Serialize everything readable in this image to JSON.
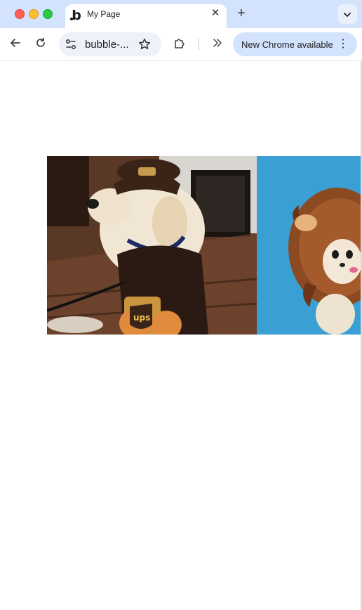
{
  "browser": {
    "tab": {
      "title": "My Page",
      "favicon": "b"
    },
    "address": {
      "text": "bubble-..."
    },
    "update_button": {
      "label": "New Chrome available"
    }
  },
  "icons": {
    "tab_close": "close-icon",
    "new_tab": "plus-icon",
    "tab_search": "chevron-down-icon",
    "back": "arrow-left-icon",
    "reload": "reload-icon",
    "site_info": "tune-icon",
    "bookmark": "star-icon",
    "extensions": "puzzle-icon",
    "overflow": "double-chevron-right-icon",
    "menu": "kebab-icon"
  },
  "images": [
    {
      "description": "dog-ups-costume"
    },
    {
      "description": "chihuahua-lion-mane"
    }
  ],
  "colors": {
    "tabstrip": "#d3e3fd",
    "omnibox": "#edf2fa",
    "update_button": "#d3e3fd"
  }
}
